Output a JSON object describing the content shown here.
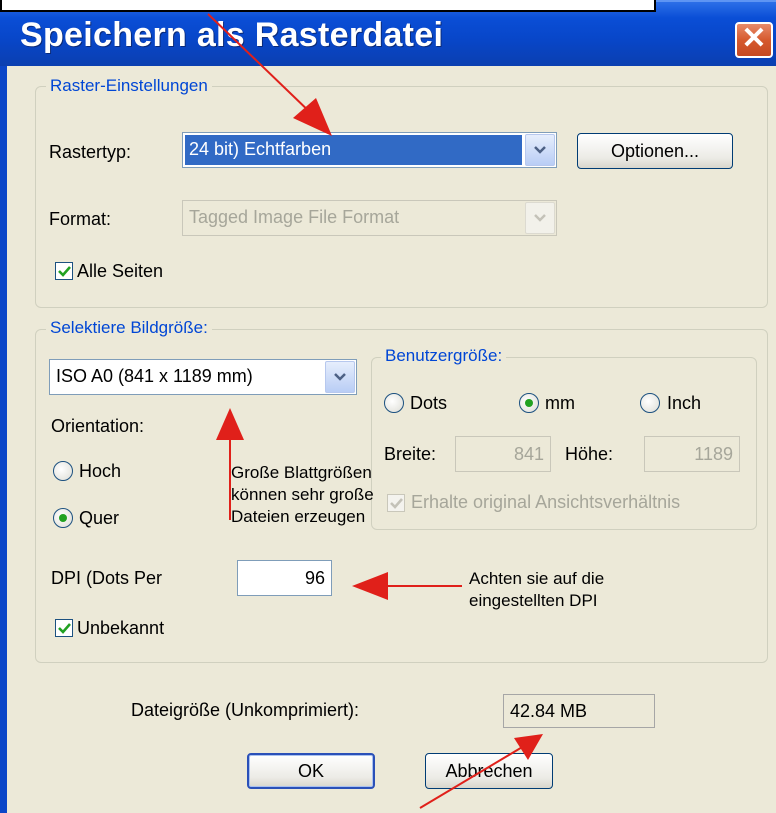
{
  "dialog": {
    "title": "Speichern als Rasterdatei",
    "close_symbol": "✕"
  },
  "raster_settings": {
    "group_label": "Raster-Einstellungen",
    "type_label": "Rastertyp:",
    "type_value": "24 bit) Echtfarben",
    "options_button": "Optionen...",
    "format_label": "Format:",
    "format_value": "Tagged Image File Format",
    "all_pages_label": "Alle Seiten",
    "all_pages_checked": true
  },
  "image_size": {
    "group_label": "Selektiere Bildgröße:",
    "size_value": "ISO A0  (841 x 1189 mm)",
    "orientation_label": "Orientation:",
    "portrait_label": "Hoch",
    "landscape_label": "Quer",
    "selected_orientation": "Quer",
    "dpi_label": "DPI (Dots Per",
    "dpi_value": "96",
    "unknown_label": "Unbekannt",
    "unknown_checked": true
  },
  "custom_size": {
    "group_label": "Benutzergröße:",
    "unit_dots": "Dots",
    "unit_mm": "mm",
    "unit_inch": "Inch",
    "selected_unit": "mm",
    "width_label": "Breite:",
    "width_value": "841",
    "height_label": "Höhe:",
    "height_value": "1189",
    "keep_ratio_label": "Erhalte original Ansichtsverhältnis",
    "keep_ratio_checked": true
  },
  "file_size": {
    "label": "Dateigröße (Unkomprimiert):",
    "value": "42.84 MB"
  },
  "buttons": {
    "ok": "OK",
    "cancel": "Abbrechen"
  },
  "annotations": {
    "large_sizes": [
      "Große Blattgrößen",
      "können sehr große",
      "Dateien erzeugen"
    ],
    "dpi_hint": [
      "Achten sie auf die",
      "eingestellten DPI"
    ],
    "arrow_color": "#e0201a"
  },
  "colors": {
    "title_bar": "#0846c8",
    "dialog_face": "#ece9d8",
    "group_label": "#0046d5",
    "selection": "#316ac5",
    "check_green": "#21a121"
  }
}
